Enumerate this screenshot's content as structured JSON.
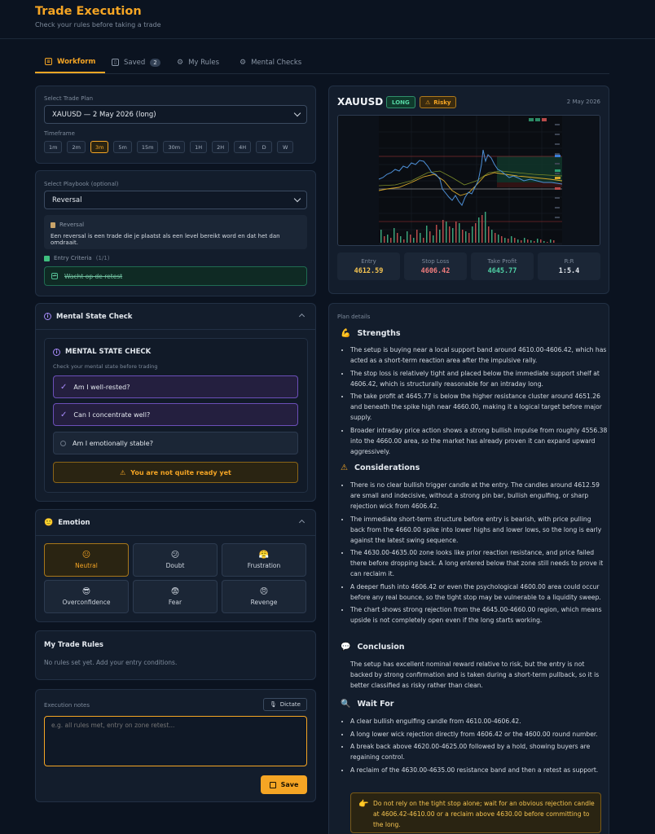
{
  "header": {
    "title": "Trade Execution",
    "subtitle": "Check your rules before taking a trade"
  },
  "tabs": [
    {
      "label": "Workform",
      "icon": "clipboard-icon"
    },
    {
      "label": "Saved",
      "badge": "2",
      "icon": "bookmark-icon"
    },
    {
      "label": "My Rules",
      "icon": "gear-icon"
    },
    {
      "label": "Mental Checks",
      "icon": "gear-icon"
    }
  ],
  "plan": {
    "label": "Select Trade Plan",
    "value": "XAUUSD — 2 May 2026 (long)",
    "timeframe_label": "Timeframe",
    "timeframes": [
      "1m",
      "2m",
      "3m",
      "5m",
      "15m",
      "30m",
      "1H",
      "2H",
      "4H",
      "D",
      "W"
    ],
    "active_timeframe": "3m"
  },
  "playbook": {
    "label": "Select Playbook (optional)",
    "value": "Reversal",
    "note_title": "Reversal",
    "note_text": "Een reversal is een trade die je plaatst als een level bereikt word en dat het dan omdraait.",
    "criteria_label": "Entry Criteria",
    "criteria_count": "(1/1)",
    "criteria_item": "Wacht op de retest"
  },
  "mental": {
    "section_title": "Mental State Check",
    "box_title": "MENTAL STATE CHECK",
    "box_sub": "Check your mental state before trading",
    "items": [
      {
        "label": "Am I well-rested?",
        "checked": true
      },
      {
        "label": "Can I concentrate well?",
        "checked": true
      },
      {
        "label": "Am I emotionally stable?",
        "checked": false
      }
    ],
    "warning": "You are not quite ready yet"
  },
  "emotion": {
    "section_title": "Emotion",
    "options": [
      {
        "label": "Neutral",
        "face": "😐",
        "active": true
      },
      {
        "label": "Doubt",
        "face": "😕",
        "active": false
      },
      {
        "label": "Frustration",
        "face": "😤",
        "active": false
      },
      {
        "label": "Overconfidence",
        "face": "😎",
        "active": false
      },
      {
        "label": "Fear",
        "face": "😨",
        "active": false
      },
      {
        "label": "Revenge",
        "face": "😠",
        "active": false
      }
    ]
  },
  "rules": {
    "title": "My Trade Rules",
    "empty": "No rules set yet. Add your entry conditions."
  },
  "notes": {
    "label": "Execution notes",
    "dictate": "Dictate",
    "placeholder": "e.g. all rules met, entry on zone retest...",
    "save": "Save"
  },
  "trade": {
    "symbol": "XAUUSD",
    "direction": "LONG",
    "risk_badge": "Risky",
    "date": "2 May 2026",
    "metrics": [
      {
        "label": "Entry",
        "value": "4612.59",
        "color": "#f5c451"
      },
      {
        "label": "Stop Loss",
        "value": "4606.42",
        "color": "#f07c7c"
      },
      {
        "label": "Take Profit",
        "value": "4645.77",
        "color": "#4fd1a5"
      },
      {
        "label": "R:R",
        "value": "1:5.4",
        "color": "#e4e9ef"
      }
    ]
  },
  "plan_details": {
    "label": "Plan details",
    "strengths_title": "Strengths",
    "strengths": [
      "The setup is buying near a local support band around 4610.00-4606.42, which has acted as a short-term reaction area after the impulsive rally.",
      "The stop loss is relatively tight and placed below the immediate support shelf at 4606.42, which is structurally reasonable for an intraday long.",
      "The take profit at 4645.77 is below the higher resistance cluster around 4651.26 and beneath the spike high near 4660.00, making it a logical target before major supply.",
      "Broader intraday price action shows a strong bullish impulse from roughly 4556.38 into the 4660.00 area, so the market has already proven it can expand upward aggressively."
    ],
    "considerations_title": "Considerations",
    "considerations": [
      "There is no clear bullish trigger candle at the entry. The candles around 4612.59 are small and indecisive, without a strong pin bar, bullish engulfing, or sharp rejection wick from 4606.42.",
      "The immediate short-term structure before entry is bearish, with price pulling back from the 4660.00 spike into lower highs and lower lows, so the long is early against the latest swing sequence.",
      "The 4630.00-4635.00 zone looks like prior reaction resistance, and price failed there before dropping back. A long entered below that zone still needs to prove it can reclaim it.",
      "A deeper flush into 4606.42 or even the psychological 4600.00 area could occur before any real bounce, so the tight stop may be vulnerable to a liquidity sweep.",
      "The chart shows strong rejection from the 4645.00-4660.00 region, which means upside is not completely open even if the long starts working."
    ],
    "conclusion_title": "Conclusion",
    "conclusion": "The setup has excellent nominal reward relative to risk, but the entry is not backed by strong confirmation and is taken during a short-term pullback, so it is better classified as risky rather than clean.",
    "wait_title": "Wait For",
    "wait": [
      "A clear bullish engulfing candle from 4610.00-4606.42.",
      "A long lower wick rejection directly from 4606.42 or the 4600.00 round number.",
      "A break back above 4620.00-4625.00 followed by a hold, showing buyers are regaining control.",
      "A reclaim of the 4630.00-4635.00 resistance band and then a retest as support."
    ],
    "tip": "Do not rely on the tight stop alone; wait for an obvious rejection candle at 4606.42-4610.00 or a reclaim above 4630.00 before committing to the long."
  }
}
